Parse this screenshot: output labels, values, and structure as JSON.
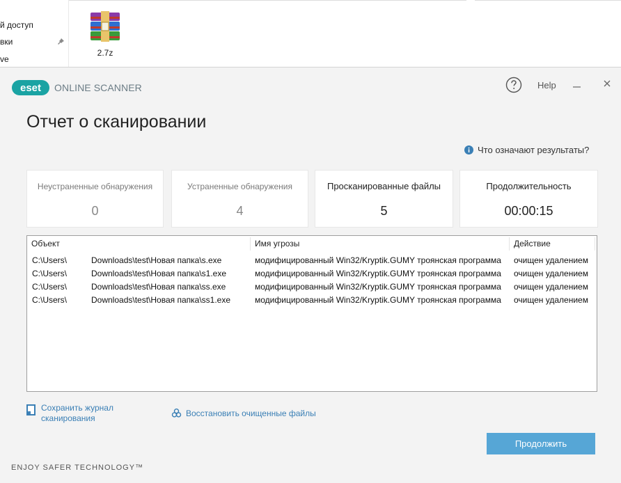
{
  "explorer": {
    "sidebar_items": [
      "й доступ",
      "вки",
      "ve"
    ],
    "file_name": "2.7z"
  },
  "window": {
    "brand": {
      "logo_text": "eset",
      "product": "ONLINE SCANNER"
    },
    "help_label": "Help",
    "title": "Отчет о сканировании",
    "results_link": "Что означают результаты?",
    "stats": [
      {
        "label": "Неустраненные обнаружения",
        "value": "0"
      },
      {
        "label": "Устраненные обнаружения",
        "value": "4"
      },
      {
        "label": "Просканированные файлы",
        "value": "5"
      },
      {
        "label": "Продолжительность",
        "value": "00:00:15"
      }
    ],
    "table": {
      "columns": [
        "Объект",
        "Имя угрозы",
        "Действие"
      ],
      "rows": [
        {
          "object_prefix": "C:\\Users\\",
          "object_path": "Downloads\\test\\Новая папка\\s.exe",
          "threat": "модифицированный Win32/Kryptik.GUMY троянская программа",
          "action": "очищен удалением"
        },
        {
          "object_prefix": "C:\\Users\\",
          "object_path": "Downloads\\test\\Новая папка\\s1.exe",
          "threat": "модифицированный Win32/Kryptik.GUMY троянская программа",
          "action": "очищен удалением"
        },
        {
          "object_prefix": "C:\\Users\\",
          "object_path": "Downloads\\test\\Новая папка\\ss.exe",
          "threat": "модифицированный Win32/Kryptik.GUMY троянская программа",
          "action": "очищен удалением"
        },
        {
          "object_prefix": "C:\\Users\\",
          "object_path": "Downloads\\test\\Новая папка\\ss1.exe",
          "threat": "модифицированный Win32/Kryptik.GUMY троянская программа",
          "action": "очищен удалением"
        }
      ]
    },
    "save_log": {
      "line1": "Сохранить журнал",
      "line2": "сканирования"
    },
    "restore_label": "Восстановить очищенные файлы",
    "continue_label": "Продолжить",
    "slogan": "ENJOY SAFER TECHNOLOGY™",
    "colors": {
      "accent": "#56a6d6",
      "link": "#3a7fb5",
      "logo": "#1aa3a3",
      "background": "#f3f3f3"
    }
  }
}
